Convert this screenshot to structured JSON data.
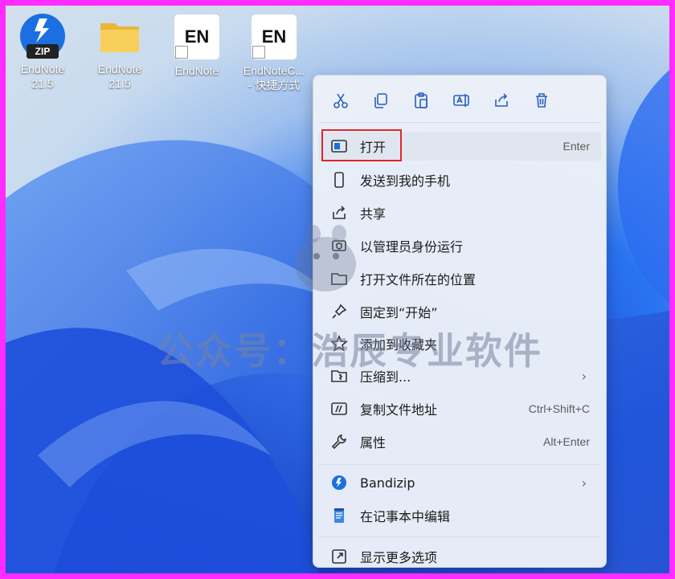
{
  "desktop": {
    "icons": [
      {
        "label": "EndNote\n21.5",
        "kind": "zip",
        "badge": "ZIP"
      },
      {
        "label": "EndNote\n21.5",
        "kind": "folder"
      },
      {
        "label": "EndNote",
        "kind": "shortcut",
        "badge": "EN"
      },
      {
        "label": "EndNoteC...\n- 快捷方式",
        "kind": "shortcut",
        "badge": "EN"
      }
    ]
  },
  "menu": {
    "toolbar": [
      "cut-icon",
      "copy-icon",
      "paste-icon",
      "rename-icon",
      "share-icon",
      "delete-icon"
    ],
    "items": [
      {
        "label": "打开",
        "shortcut": "Enter",
        "icon": "open-icon"
      },
      {
        "label": "发送到我的手机",
        "icon": "phone-icon"
      },
      {
        "label": "共享",
        "icon": "share-icon"
      },
      {
        "label": "以管理员身份运行",
        "icon": "admin-icon"
      },
      {
        "label": "打开文件所在的位置",
        "icon": "folder-icon"
      },
      {
        "label": "固定到“开始”",
        "icon": "pin-icon"
      },
      {
        "label": "添加到收藏夹",
        "icon": "star-icon"
      },
      {
        "label": "压缩到...",
        "submenu": "›",
        "icon": "compress-icon"
      },
      {
        "label": "复制文件地址",
        "shortcut": "Ctrl+Shift+C",
        "icon": "copy-path-icon"
      },
      {
        "label": "属性",
        "shortcut": "Alt+Enter",
        "icon": "wrench-icon"
      },
      {
        "label": "Bandizip",
        "submenu": "›",
        "icon": "bandizip-icon"
      },
      {
        "label": "在记事本中编辑",
        "icon": "notepad-icon"
      },
      {
        "label": "显示更多选项",
        "icon": "more-options-icon"
      }
    ]
  },
  "watermark": "公众号：浩辰专业软件",
  "colors": {
    "accent": "#1b6fe0",
    "highlight": "#e0262b",
    "frame": "#ff2bff"
  }
}
